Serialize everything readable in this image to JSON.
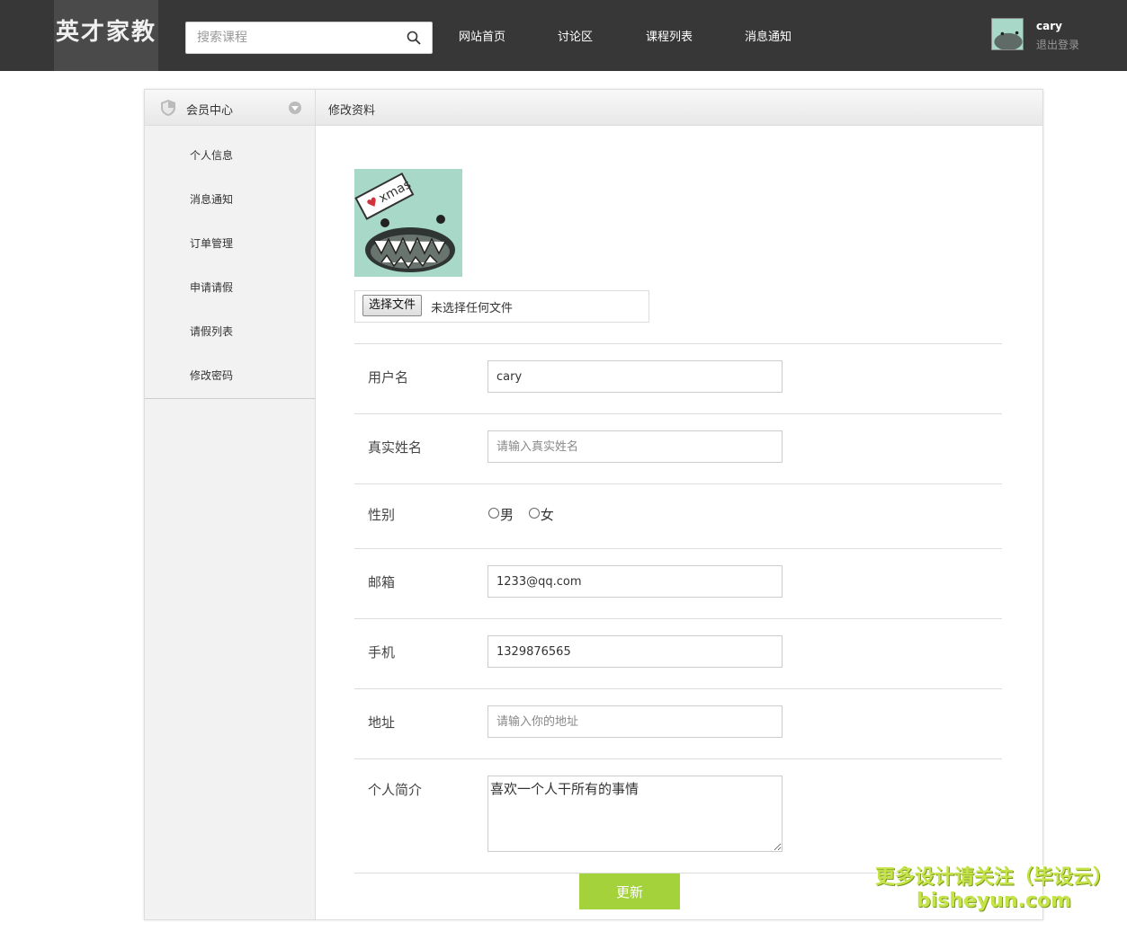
{
  "header": {
    "logo": "英才家教",
    "search_placeholder": "搜索课程",
    "nav": [
      "网站首页",
      "讨论区",
      "课程列表",
      "消息通知"
    ],
    "username": "cary",
    "logout": "退出登录"
  },
  "sidebar": {
    "title": "会员中心",
    "items": [
      "个人信息",
      "消息通知",
      "订单管理",
      "申请请假",
      "请假列表",
      "修改密码"
    ]
  },
  "content": {
    "title": "修改资料",
    "file_button": "选择文件",
    "file_status": "未选择任何文件",
    "form": {
      "username_label": "用户名",
      "username_value": "cary",
      "realname_label": "真实姓名",
      "realname_placeholder": "请输入真实姓名",
      "gender_label": "性别",
      "gender_options": [
        "男",
        "女"
      ],
      "email_label": "邮箱",
      "email_value": "1233@qq.com",
      "phone_label": "手机",
      "phone_value": "1329876565",
      "address_label": "地址",
      "address_placeholder": "请输入你的地址",
      "bio_label": "个人简介",
      "bio_value": "喜欢一个人干所有的事情"
    },
    "submit": "更新"
  },
  "watermark": {
    "line1": "更多设计请关注（毕设云）",
    "line2": "bisheyun.com"
  },
  "colors": {
    "topbar": "#373737",
    "accent": "#a4d23a",
    "avatar_bg": "#a8d8c8"
  }
}
